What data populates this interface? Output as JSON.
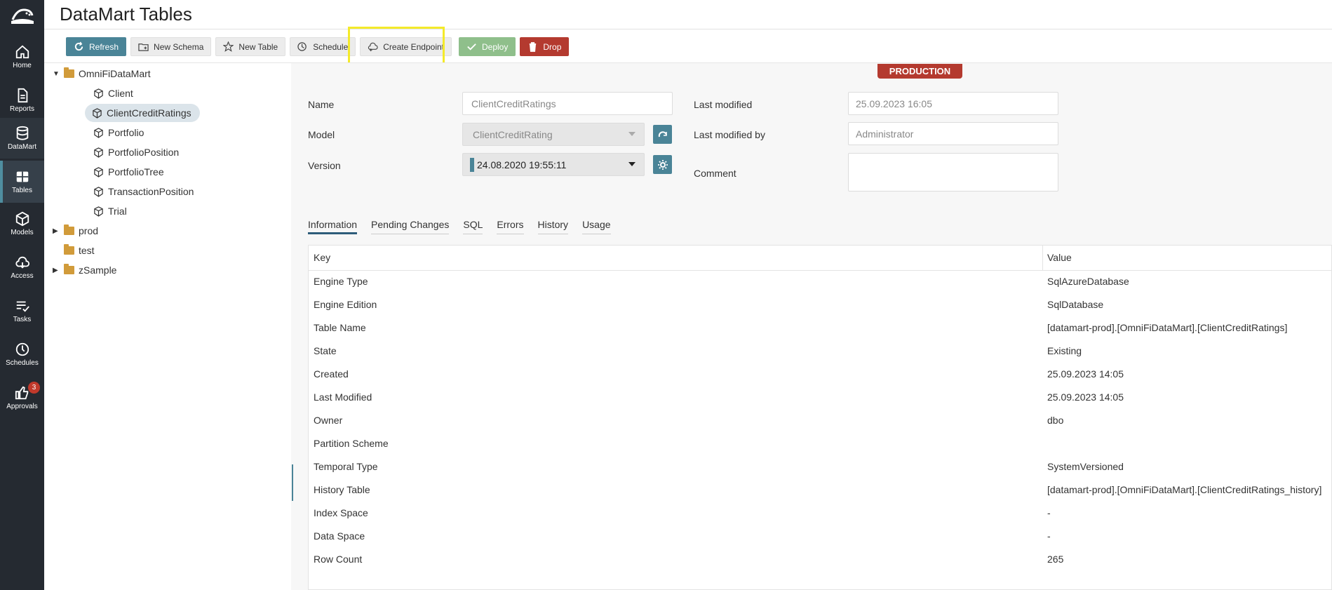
{
  "app": {
    "title": "DataMart Tables"
  },
  "nav": {
    "items": [
      {
        "label": "Home",
        "icon": "home-icon"
      },
      {
        "label": "Reports",
        "icon": "document-icon"
      },
      {
        "label": "DataMart",
        "icon": "database-icon"
      },
      {
        "label": "Tables",
        "icon": "table-icon"
      },
      {
        "label": "Models",
        "icon": "cube-icon"
      },
      {
        "label": "Access",
        "icon": "cloud-icon"
      },
      {
        "label": "Tasks",
        "icon": "checklist-icon"
      },
      {
        "label": "Schedules",
        "icon": "clock-icon"
      },
      {
        "label": "Approvals",
        "icon": "thumbs-up-icon",
        "badge": "3"
      }
    ]
  },
  "toolbar": {
    "refresh": "Refresh",
    "new_schema": "New Schema",
    "new_table": "New Table",
    "schedule": "Schedule",
    "create_endpoint": "Create Endpoint",
    "deploy": "Deploy",
    "drop": "Drop"
  },
  "tree": {
    "root": "OmniFiDataMart",
    "tables": [
      "Client",
      "ClientCreditRatings",
      "Portfolio",
      "PortfolioPosition",
      "PortfolioTree",
      "TransactionPosition",
      "Trial"
    ],
    "selected": "ClientCreditRatings",
    "other_schemas": [
      "prod",
      "test",
      "zSample"
    ]
  },
  "env_badge": "PRODUCTION",
  "form": {
    "name_label": "Name",
    "name_value": "ClientCreditRatings",
    "model_label": "Model",
    "model_value": "ClientCreditRating",
    "version_label": "Version",
    "version_value": "24.08.2020 19:55:11",
    "last_modified_label": "Last modified",
    "last_modified_value": "25.09.2023 16:05",
    "last_modified_by_label": "Last modified by",
    "last_modified_by_value": "Administrator",
    "comment_label": "Comment",
    "comment_value": ""
  },
  "tabs": [
    "Information",
    "Pending Changes",
    "SQL",
    "Errors",
    "History",
    "Usage"
  ],
  "active_tab": "Information",
  "info_table": {
    "headers": [
      "Key",
      "Value"
    ],
    "rows": [
      [
        "Engine Type",
        "SqlAzureDatabase"
      ],
      [
        "Engine Edition",
        "SqlDatabase"
      ],
      [
        "Table Name",
        "[datamart-prod].[OmniFiDataMart].[ClientCreditRatings]"
      ],
      [
        "State",
        "Existing"
      ],
      [
        "Created",
        "25.09.2023 14:05"
      ],
      [
        "Last Modified",
        "25.09.2023 14:05"
      ],
      [
        "Owner",
        "dbo"
      ],
      [
        "Partition Scheme",
        ""
      ],
      [
        "Temporal Type",
        "SystemVersioned"
      ],
      [
        "History Table",
        "[datamart-prod].[OmniFiDataMart].[ClientCreditRatings_history]"
      ],
      [
        "Index Space",
        "-"
      ],
      [
        "Data Space",
        "-"
      ],
      [
        "Row Count",
        "265"
      ]
    ]
  },
  "colors": {
    "accent": "#4a8497",
    "rail": "#252a31",
    "danger": "#b43a2f",
    "success": "#8fbf8b",
    "highlight": "#f4ea2a"
  }
}
